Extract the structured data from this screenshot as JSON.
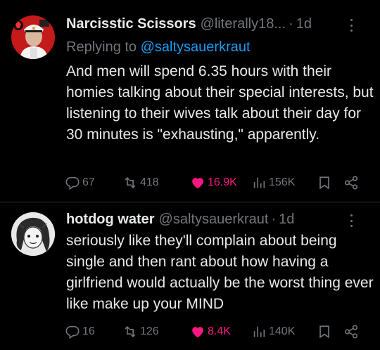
{
  "tweets": [
    {
      "author_name": "Narcisstic Scissors",
      "handle": "@literally18...",
      "separator": "·",
      "time": "1d",
      "reply_prefix": "Replying to",
      "reply_to": "@saltysauerkraut",
      "text": "And men will spend 6.35 hours with their homies talking about their special interests, but listening to their wives talk about their day for 30 minutes is \"exhausting,\" apparently.",
      "replies": "67",
      "retweets": "418",
      "likes": "16.9K",
      "views": "156K"
    },
    {
      "author_name": "hotdog water",
      "handle": "@saltysauerkraut",
      "separator": "·",
      "time": "1d",
      "text": "seriously like they'll complain about being single and then rant about how having a girlfriend would actually be the worst thing ever like make up your MIND",
      "replies": "16",
      "retweets": "126",
      "likes": "8.4K",
      "views": "140K"
    }
  ],
  "icons": {
    "reply": "reply-icon",
    "retweet": "retweet-icon",
    "like": "heart-icon",
    "views": "views-icon",
    "bookmark": "bookmark-icon",
    "share": "share-icon",
    "more": "more-icon"
  },
  "colors": {
    "background": "#000000",
    "text": "#e7e9ea",
    "muted": "#71767b",
    "link": "#1d9bf0",
    "liked": "#f91880"
  }
}
